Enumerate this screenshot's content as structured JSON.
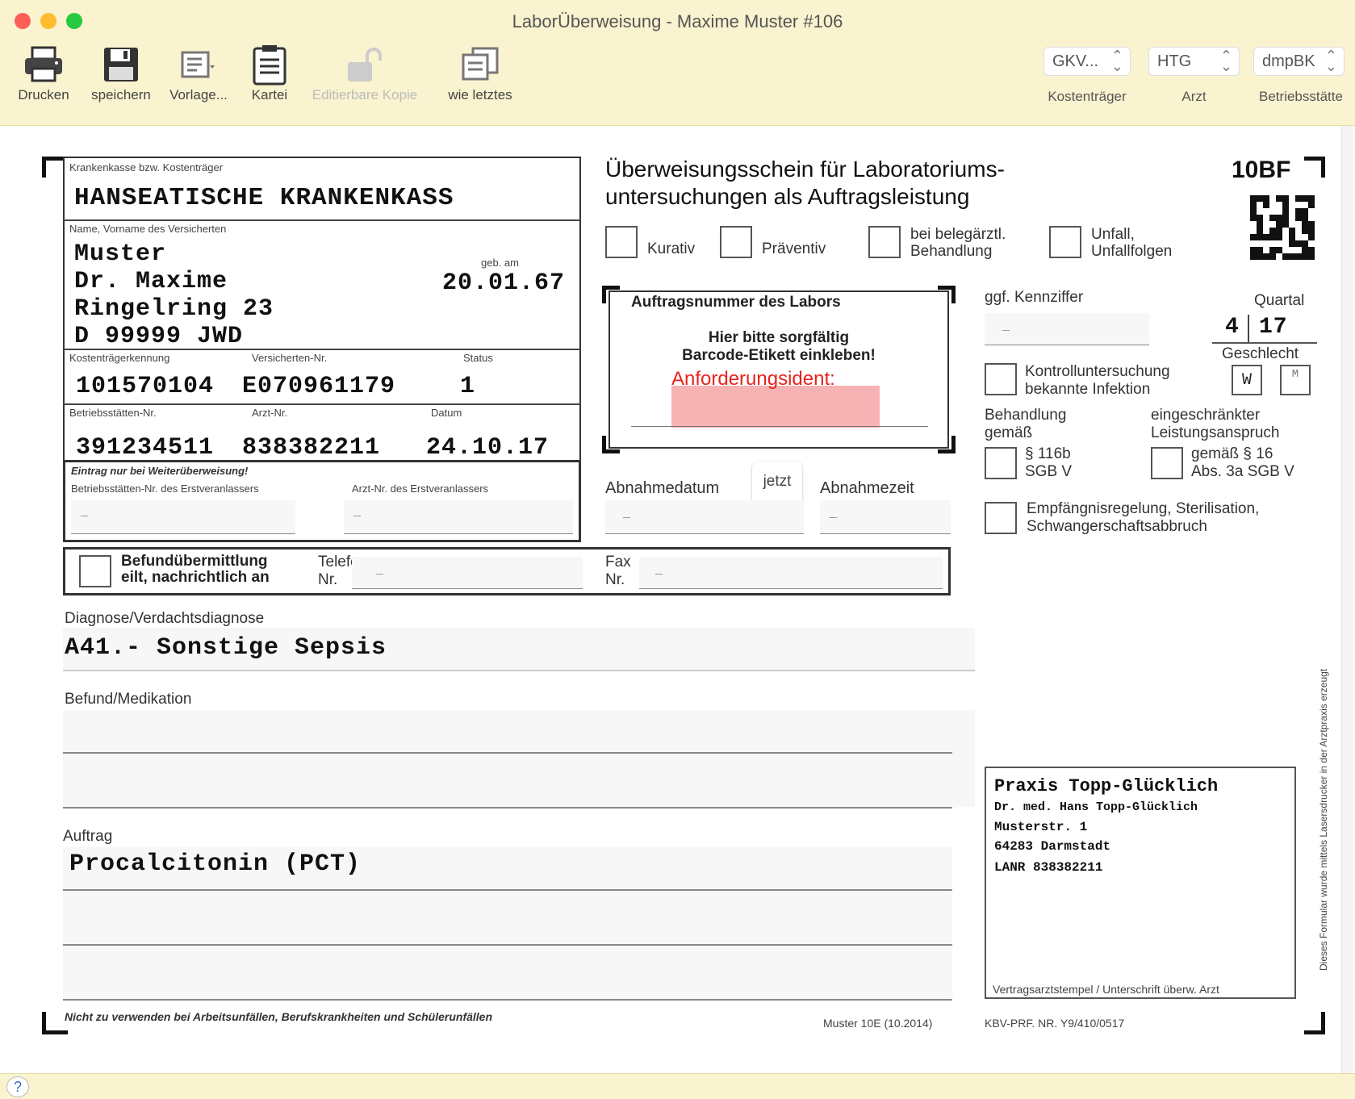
{
  "window": {
    "title": "LaborÜberweisung -  Maxime Muster #106",
    "traffic_colors": {
      "close": "#ff5f57",
      "minimize": "#febc2e",
      "zoom": "#28c840"
    }
  },
  "toolbar": {
    "print_label": "Drucken",
    "save_label": "speichern",
    "template_label": "Vorlage...",
    "kartei_label": "Kartei",
    "editable_copy_label": "Editierbare Kopie",
    "like_last_label": "wie letztes",
    "kostentraeger_value": "GKV...",
    "kostentraeger_label": "Kostenträger",
    "arzt_value": "HTG",
    "arzt_label": "Arzt",
    "betriebsstaette_value": "dmpBK",
    "betriebsstaette_label": "Betriebsstätte"
  },
  "form": {
    "form_code": "10BF",
    "heading_line1": "Überweisungsschein für Laboratoriums-",
    "heading_line2": "untersuchungen als Auftragsleistung",
    "kasse_label": "Krankenkasse bzw. Kostenträger",
    "kasse_value": "HANSEATISCHE KRANKENKASS",
    "name_label": "Name, Vorname des Versicherten",
    "name_line1": "Muster",
    "name_line2": "Dr. Maxime",
    "name_line3": "Ringelring 23",
    "name_line4": "D 99999 JWD",
    "geb_label": "geb. am",
    "geb_value": "20.01.67",
    "kostentraegerkennung_label": "Kostenträgerkennung",
    "kostentraegerkennung_value": "101570104",
    "versicherten_label": "Versicherten-Nr.",
    "versicherten_value": "E070961179",
    "status_label": "Status",
    "status_value": "1",
    "betriebsstaetten_label": "Betriebsstätten-Nr.",
    "betriebsstaetten_value": "391234511",
    "arzt_nr_label": "Arzt-Nr.",
    "arzt_nr_value": "838382211",
    "datum_label": "Datum",
    "datum_value": "24.10.17",
    "weiterueberweisung_note": "Eintrag nur bei Weiterüberweisung!",
    "bsnr_erst_label": "Betriebsstätten-Nr. des Erstveranlassers",
    "bsnr_erst_value": "_",
    "lanr_erst_label": "Arzt-Nr. des Erstveranlassers",
    "lanr_erst_value": "_",
    "kurativ_label": "Kurativ",
    "praeventiv_label": "Präventiv",
    "belegaerztl_line1": "bei belegärztl.",
    "belegaerztl_line2": "Behandlung",
    "unfall_line1": "Unfall,",
    "unfall_line2": "Unfallfolgen",
    "auftragsnummer_label": "Auftragsnummer des Labors",
    "barcode_line1": "Hier bitte sorgfältig",
    "barcode_line2": "Barcode-Etikett einkleben!",
    "anforderungsident_label": "Anforderungsident:",
    "kennziffer_label": "ggf. Kennziffer",
    "kennziffer_value": "_",
    "quartal_label": "Quartal",
    "quartal_q": "4",
    "quartal_y": "17",
    "geschlecht_label": "Geschlecht",
    "geschlecht_w": "W",
    "geschlecht_m": "M",
    "kontroll_line1": "Kontrolluntersuchung",
    "kontroll_line2": "bekannte Infektion",
    "behandlung_line1": "Behandlung",
    "behandlung_line2": "gemäß",
    "sgb116_line1": "§ 116b",
    "sgb116_line2": "SGB V",
    "eingeschr_line1": "eingeschränkter",
    "eingeschr_line2": "Leistungsanspruch",
    "sgb16_line1": "gemäß § 16",
    "sgb16_line2": "Abs. 3a SGB V",
    "empfaengnis_line1": "Empfängnisregelung, Sterilisation,",
    "empfaengnis_line2": "Schwangerschaftsabbruch",
    "abnahmedatum_label": "Abnahmedatum",
    "abnahmedatum_value": "_",
    "jetzt_button": "jetzt",
    "abnahmezeit_label": "Abnahmezeit",
    "abnahmezeit_value": "_",
    "befund_line1": "Befundübermittlung",
    "befund_line2": "eilt, nachrichtlich an",
    "telefon_line1": "Telefon",
    "telefon_line2": "Nr.",
    "telefon_value": "_",
    "fax_line1": "Fax",
    "fax_line2": "Nr.",
    "fax_value": "_",
    "diagnose_label": "Diagnose/Verdachtsdiagnose",
    "diagnose_value": "A41.- Sonstige Sepsis",
    "befund_med_label": "Befund/Medikation",
    "auftrag_label": "Auftrag",
    "auftrag_value": "Procalcitonin (PCT)",
    "stamp_line1": "Praxis Topp-Glücklich",
    "stamp_line2": "Dr. med. Hans Topp-Glücklich",
    "stamp_line3": "Musterstr. 1",
    "stamp_line4": "64283 Darmstadt",
    "stamp_line5": "LANR 838382211",
    "stamp_caption": "Vertragsarztstempel / Unterschrift überw. Arzt",
    "footer_note": "Nicht zu verwenden bei Arbeitsunfällen, Berufskrankheiten und Schülerunfällen",
    "muster_label": "Muster 10E (10.2014)",
    "kbv_label": "KBV-PRF. NR. Y9/410/0517",
    "side_text": "Dieses Formular wurde mittels Lasersdrucker in der Arztpraxis erzeugt",
    "barcode_fill_color": "#f7b3b3",
    "anforderung_color": "#e8231c"
  }
}
